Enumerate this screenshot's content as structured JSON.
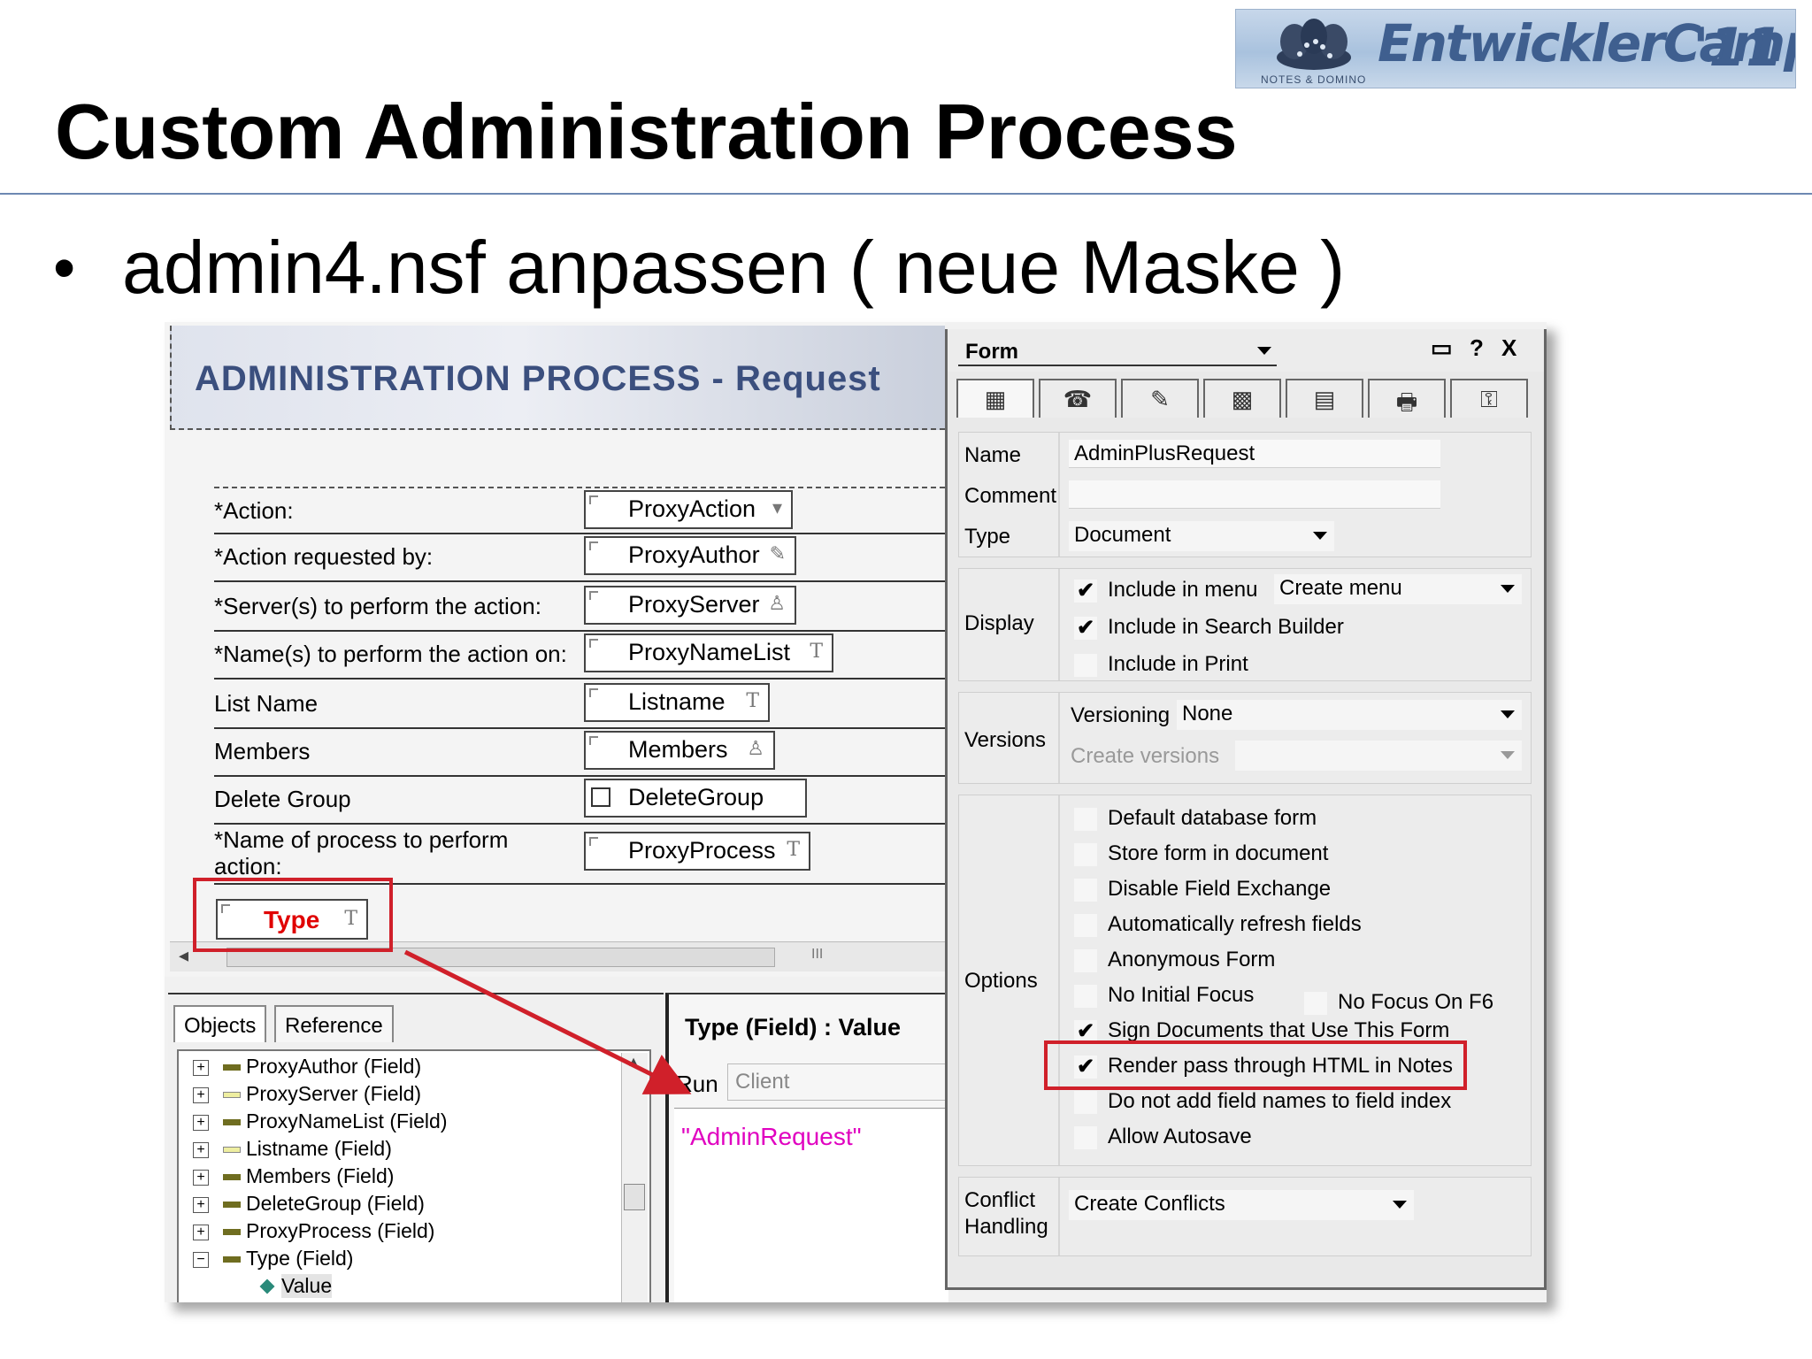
{
  "slide": {
    "title": "Custom Administration Process",
    "bullet": "admin4.nsf anpassen ( neue Maske )"
  },
  "logo": {
    "brand": "EntwicklerCamp",
    "year": "'11",
    "sub": "NOTES & DOMINO"
  },
  "form": {
    "banner": "ADMINISTRATION PROCESS  -  Request",
    "rows": [
      {
        "label": "*Action:",
        "field": "ProxyAction",
        "glyph": "▾"
      },
      {
        "label": "*Action requested by:",
        "field": "ProxyAuthor",
        "glyph": "✎"
      },
      {
        "label": "*Server(s) to perform the action:",
        "field": "ProxyServer",
        "glyph": "♙"
      },
      {
        "label": "*Name(s) to perform the action on:",
        "field": "ProxyNameList",
        "glyph": "T"
      },
      {
        "label": "List Name",
        "field": "Listname",
        "glyph": "T"
      },
      {
        "label": "Members",
        "field": "Members",
        "glyph": "♙"
      },
      {
        "label": "Delete Group",
        "field": "DeleteGroup",
        "glyph": ""
      },
      {
        "label": "*Name of process to perform action:",
        "field": "ProxyProcess",
        "glyph": "T"
      }
    ],
    "type_field": "Type",
    "type_glyph": "T",
    "hscroll_mark": "III"
  },
  "objects": {
    "tabs": [
      "Objects",
      "Reference"
    ],
    "items": [
      {
        "expander": "+",
        "text": "ProxyAuthor (Field)"
      },
      {
        "expander": "+",
        "text": "ProxyServer (Field)"
      },
      {
        "expander": "+",
        "text": "ProxyNameList (Field)"
      },
      {
        "expander": "+",
        "text": "Listname (Field)"
      },
      {
        "expander": "+",
        "text": "Members (Field)"
      },
      {
        "expander": "+",
        "text": "DeleteGroup (Field)"
      },
      {
        "expander": "+",
        "text": "ProxyProcess (Field)"
      },
      {
        "expander": "−",
        "text": "Type (Field)"
      },
      {
        "expander": "",
        "text": "Value"
      }
    ]
  },
  "code": {
    "title": "Type (Field) : Value",
    "run_label": "Run",
    "run_value": "Client",
    "formula": "\"AdminRequest\""
  },
  "properties": {
    "header": "Form",
    "controls": [
      "▭",
      "?",
      "X"
    ],
    "tab_icons": [
      "▦",
      "☎",
      "✎",
      "▩",
      "▤",
      "🖶",
      "⚿"
    ],
    "basics": {
      "name_label": "Name",
      "name_value": "AdminPlusRequest",
      "comment_label": "Comment",
      "comment_value": "",
      "type_label": "Type",
      "type_value": "Document"
    },
    "display": {
      "label": "Display",
      "items": [
        {
          "checked": true,
          "text": "Include in menu"
        },
        {
          "checked": true,
          "text": "Include in Search Builder"
        },
        {
          "checked": false,
          "text": "Include in Print"
        }
      ],
      "menu_value": "Create menu"
    },
    "versions": {
      "label": "Versions",
      "versioning_label": "Versioning",
      "versioning_value": "None",
      "create_label": "Create versions",
      "create_value": ""
    },
    "options": {
      "label": "Options",
      "items": [
        {
          "checked": false,
          "text": "Default database form"
        },
        {
          "checked": false,
          "text": "Store form in document"
        },
        {
          "checked": false,
          "text": "Disable Field Exchange"
        },
        {
          "checked": false,
          "text": "Automatically refresh fields"
        },
        {
          "checked": false,
          "text": "Anonymous Form"
        },
        {
          "checked": false,
          "text": "No Initial Focus"
        },
        {
          "checked": true,
          "text": "Sign Documents that Use This Form"
        },
        {
          "checked": true,
          "text": "Render pass through HTML in Notes"
        },
        {
          "checked": false,
          "text": "Do not add field names to field index"
        },
        {
          "checked": false,
          "text": "Allow Autosave"
        }
      ],
      "extra": {
        "checked": false,
        "text": "No Focus On F6"
      }
    },
    "conflict": {
      "label_line1": "Conflict",
      "label_line2": "Handling",
      "value": "Create Conflicts"
    }
  },
  "colors": {
    "highlight": "#d0202a",
    "banner_text": "#3b4f7e",
    "formula": "#e000c0",
    "type_text": "#e00000"
  }
}
